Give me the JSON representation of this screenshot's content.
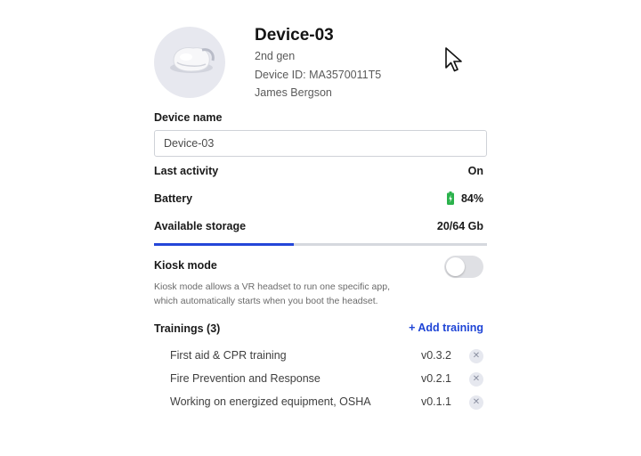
{
  "device": {
    "title": "Device-03",
    "generation": "2nd gen",
    "device_id": "Device ID: MA3570011T5",
    "owner": "James Bergson"
  },
  "device_name": {
    "label": "Device name",
    "value": "Device-03"
  },
  "last_activity": {
    "label": "Last activity",
    "value": "On"
  },
  "battery": {
    "label": "Battery",
    "value": "84%",
    "color": "#2bb24c"
  },
  "storage": {
    "label": "Available storage",
    "value": "20/64 Gb",
    "used_fraction": 0.42,
    "fill_color": "#2446d8"
  },
  "kiosk": {
    "label": "Kiosk mode",
    "enabled": false,
    "description_line1": "Kiosk mode allows a VR headset to run one specific app,",
    "description_line2": "which automatically starts when you boot the headset."
  },
  "trainings": {
    "label": "Trainings (3)",
    "add_label": "+ Add training",
    "items": [
      {
        "name": "First aid & CPR training",
        "version": "v0.3.2"
      },
      {
        "name": "Fire Prevention and Response",
        "version": "v0.2.1"
      },
      {
        "name": "Working on energized equipment, OSHA",
        "version": "v0.1.1"
      }
    ]
  },
  "icons": {
    "avatar": "vr-headset-image",
    "battery": "battery-charging-icon",
    "remove": "close-icon",
    "cursor": "mouse-pointer-icon"
  },
  "colors": {
    "accent": "#1f45d6"
  }
}
